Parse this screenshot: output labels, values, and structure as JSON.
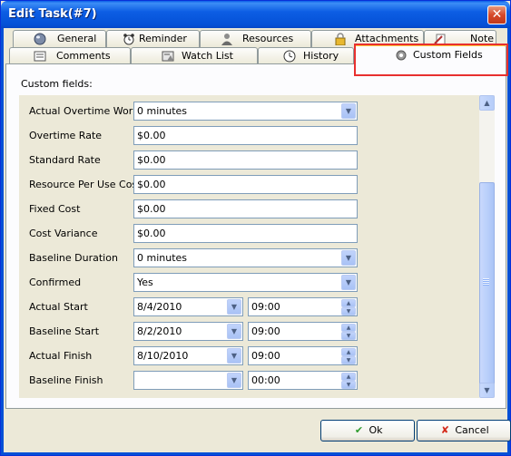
{
  "window": {
    "title": "Edit Task(#7)",
    "close_glyph": "✕"
  },
  "tabs_row1": [
    {
      "label": "General",
      "icon": "globe-icon"
    },
    {
      "label": "Reminder",
      "icon": "alarm-clock-icon"
    },
    {
      "label": "Resources",
      "icon": "person-icon"
    },
    {
      "label": "Attachments",
      "icon": "lock-icon"
    },
    {
      "label": "Note",
      "icon": "note-icon"
    }
  ],
  "tabs_row2": [
    {
      "label": "Comments",
      "icon": "comments-icon"
    },
    {
      "label": "Watch List",
      "icon": "watch-list-icon"
    },
    {
      "label": "History",
      "icon": "history-icon"
    },
    {
      "label": "Custom Fields",
      "icon": "gear-icon",
      "active": true
    }
  ],
  "panel": {
    "caption": "Custom fields:"
  },
  "fields": [
    {
      "label": "Actual Overtime Work",
      "value": "0 minutes",
      "kind": "dropdown"
    },
    {
      "label": "Overtime Rate",
      "value": "$0.00",
      "kind": "text"
    },
    {
      "label": "Standard Rate",
      "value": "$0.00",
      "kind": "text"
    },
    {
      "label": "Resource Per Use Cost",
      "value": "$0.00",
      "kind": "text"
    },
    {
      "label": "Fixed Cost",
      "value": "$0.00",
      "kind": "text"
    },
    {
      "label": "Cost Variance",
      "value": "$0.00",
      "kind": "text"
    },
    {
      "label": "Baseline Duration",
      "value": "0 minutes",
      "kind": "dropdown"
    },
    {
      "label": "Confirmed",
      "value": "Yes",
      "kind": "dropdown"
    },
    {
      "label": "Actual Start",
      "date": "8/4/2010",
      "time": "09:00",
      "kind": "datetime"
    },
    {
      "label": "Baseline Start",
      "date": "8/2/2010",
      "time": "09:00",
      "kind": "datetime"
    },
    {
      "label": "Actual Finish",
      "date": "8/10/2010",
      "time": "09:00",
      "kind": "datetime"
    },
    {
      "label": "Baseline Finish",
      "date": "",
      "time": "00:00",
      "kind": "datetime"
    }
  ],
  "buttons": {
    "ok_label": "Ok",
    "cancel_label": "Cancel"
  },
  "colors": {
    "title_bar": "#0450d6",
    "active_tab_highlight": "#e8302e",
    "ok_check": "#2e9b2e",
    "cancel_x": "#d42a1a"
  }
}
